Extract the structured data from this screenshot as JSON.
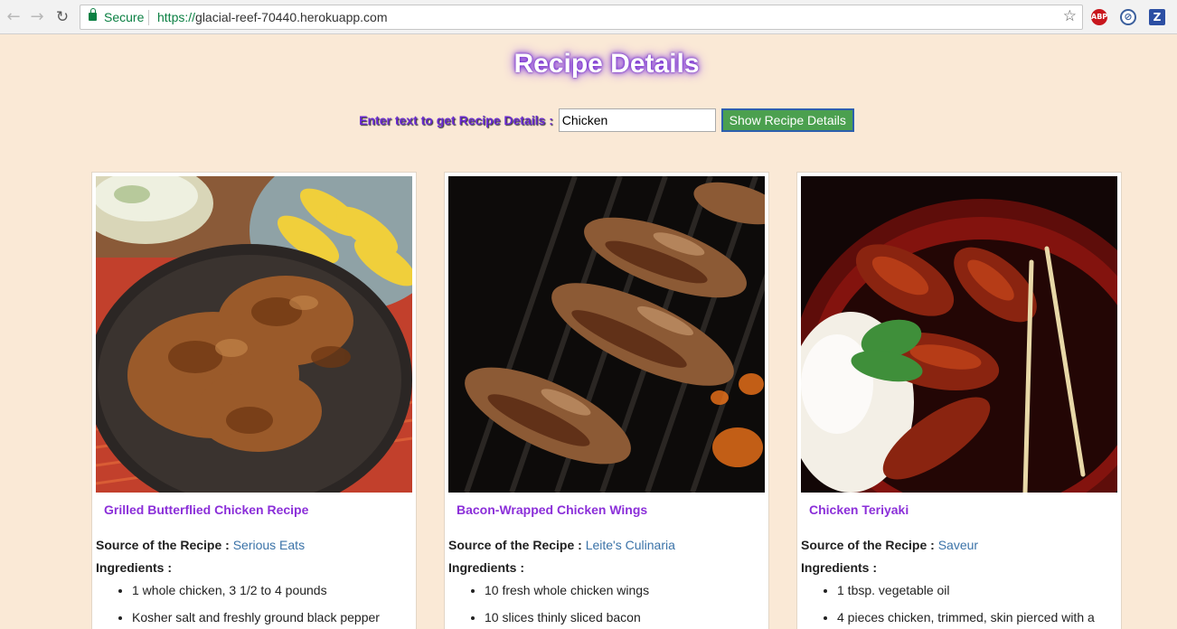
{
  "browser": {
    "secure_label": "Secure",
    "url_scheme": "https://",
    "url_host": "glacial-reef-70440.herokuapp.com",
    "ext_abp": "ABP",
    "ext_z": "Z"
  },
  "page": {
    "title": "Recipe Details",
    "search_label": "Enter text to get Recipe Details :",
    "search_value": "Chicken",
    "search_button": "Show Recipe Details"
  },
  "labels": {
    "source": "Source of the Recipe :",
    "ingredients": "Ingredients :"
  },
  "recipes": [
    {
      "title": "Grilled Butterflied Chicken Recipe",
      "source": "Serious Eats",
      "ingredients": [
        "1 whole chicken, 3 1/2 to 4 pounds",
        "Kosher salt and freshly ground black pepper"
      ]
    },
    {
      "title": "Bacon-Wrapped Chicken Wings",
      "source": "Leite's Culinaria",
      "ingredients": [
        "10 fresh whole chicken wings",
        "10 slices thinly sliced bacon"
      ]
    },
    {
      "title": "Chicken Teriyaki",
      "source": "Saveur",
      "ingredients": [
        "1 tbsp. vegetable oil",
        "4 pieces chicken, trimmed, skin pierced with a"
      ]
    }
  ],
  "colors": {
    "background": "#fae9d6",
    "title_glow": "#6a1fd1",
    "recipe_title": "#8b2fd9",
    "link": "#3b73a8",
    "button": "#4ba04f"
  }
}
